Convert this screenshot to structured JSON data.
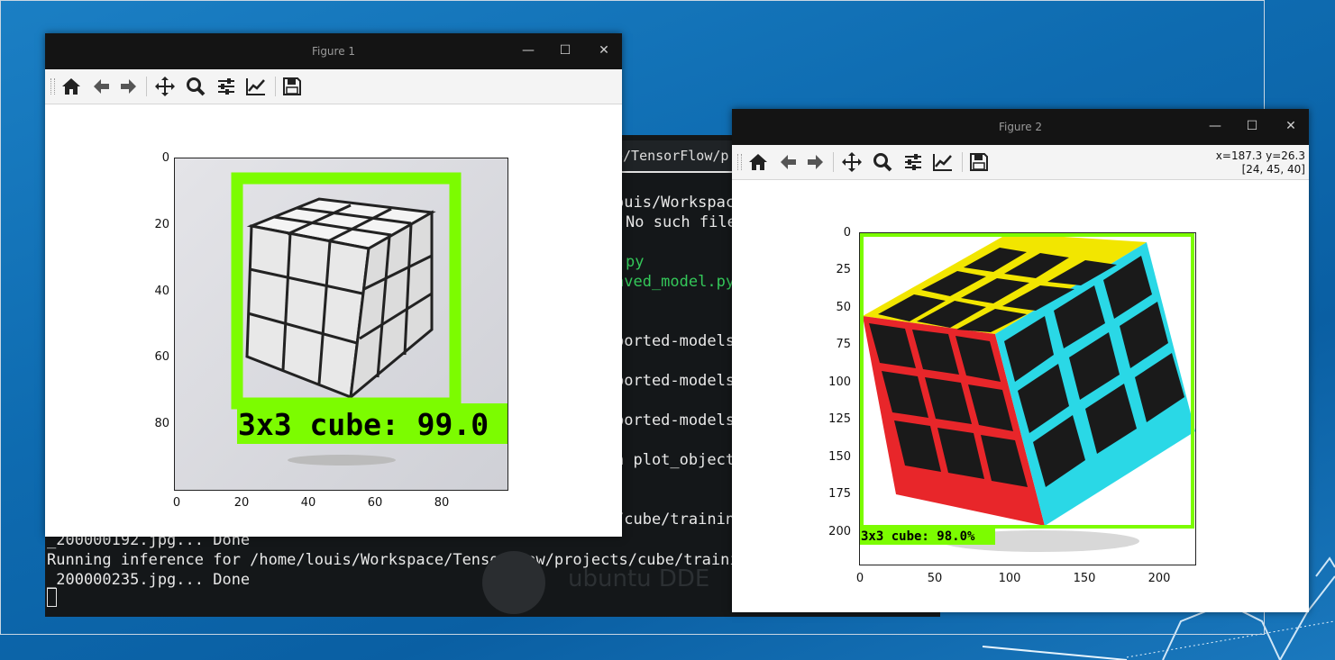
{
  "terminal": {
    "tab_title": "e/TensorFlow/p",
    "lines_right": [
      "ouis/Workspace",
      "No such file",
      "py",
      "aved_model.py",
      "ported-models",
      "ported-models",
      "ported-models",
      "n plot_object",
      "/cube/trainin"
    ],
    "lines_bottom": [
      "_200000192.jpg... Done",
      "Running inference for /home/louis/Workspace/TensorFlow/projects/cube/trainin",
      "_200000235.jpg... Done"
    ],
    "watermark": "ubuntu DDE"
  },
  "figure1": {
    "title": "Figure 1",
    "toolbar": [
      "home-icon",
      "back-icon",
      "forward-icon",
      "pan-icon",
      "zoom-icon",
      "configure-subplots-icon",
      "edit-axis-icon",
      "save-icon"
    ],
    "yticks": [
      "0",
      "20",
      "40",
      "60",
      "80"
    ],
    "xticks": [
      "0",
      "20",
      "40",
      "60",
      "80"
    ],
    "label": "3x3 cube: 99.0",
    "box_color": "#7cfc00"
  },
  "figure2": {
    "title": "Figure 2",
    "coord_line1": "x=187.3 y=26.3",
    "coord_line2": "[24, 45, 40]",
    "toolbar": [
      "home-icon",
      "back-icon",
      "forward-icon",
      "pan-icon",
      "zoom-icon",
      "configure-subplots-icon",
      "edit-axis-icon",
      "save-icon"
    ],
    "yticks": [
      "0",
      "25",
      "50",
      "75",
      "100",
      "125",
      "150",
      "175",
      "200"
    ],
    "xticks": [
      "0",
      "50",
      "100",
      "150",
      "200"
    ],
    "label": "3x3 cube: 98.0%",
    "box_color": "#7cfc00"
  },
  "window_buttons": {
    "minimize": "—",
    "maximize": "☐",
    "close": "✕"
  }
}
